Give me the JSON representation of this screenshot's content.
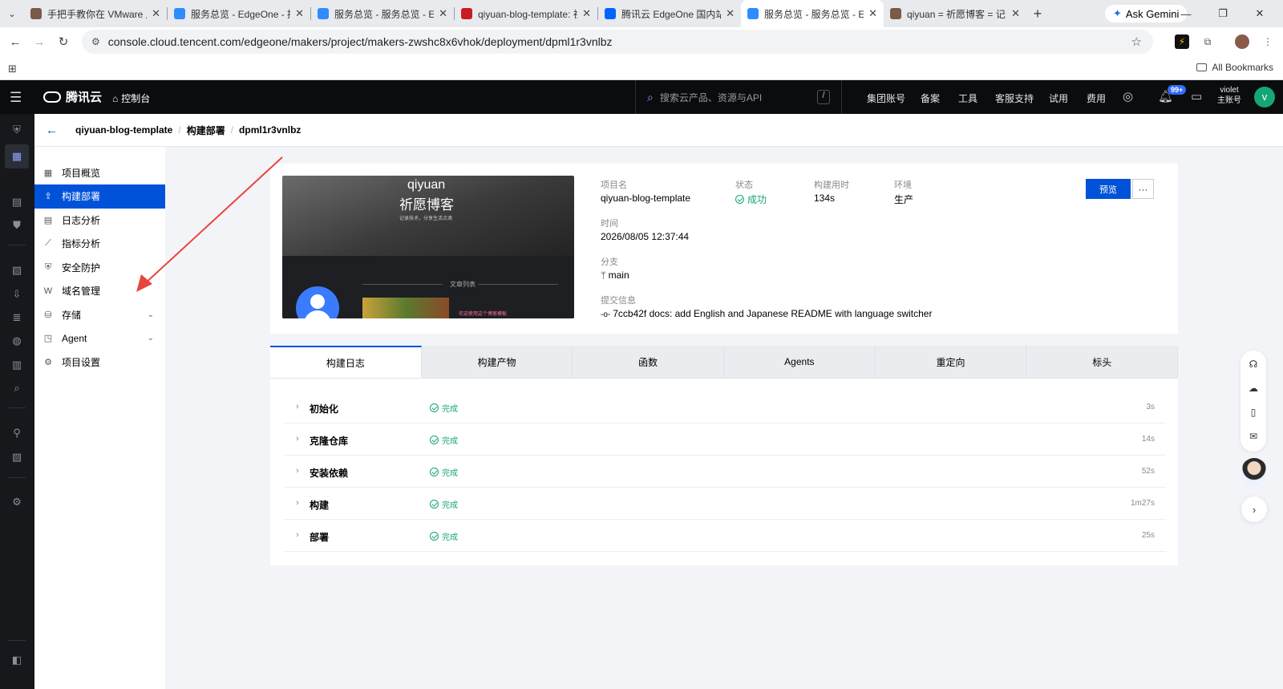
{
  "browser": {
    "tabs": [
      {
        "title": "手把手教你在 VMware 虚拟",
        "favicon_color": "#7a5a4a",
        "active": false
      },
      {
        "title": "服务总览 - EdgeOne - 控制",
        "favicon_color": "#2f8cff",
        "active": false
      },
      {
        "title": "服务总览 - 服务总览 - Edg",
        "favicon_color": "#2f8cff",
        "active": false
      },
      {
        "title": "qiyuan-blog-template: 祈",
        "favicon_color": "#c71d23",
        "active": false
      },
      {
        "title": "腾讯云 EdgeOne 国内站 Cl",
        "favicon_color": "#0066ff",
        "active": false
      },
      {
        "title": "服务总览 - 服务总览 - Edg",
        "favicon_color": "#2f8cff",
        "active": true
      },
      {
        "title": "qiyuan = 祈愿博客 = 记录",
        "favicon_color": "#7a5a4a",
        "active": false
      }
    ],
    "gemini_label": "Ask Gemini",
    "url": "console.cloud.tencent.com/edgeone/makers/project/makers-zwshc8x6vhok/deployment/dpml1r3vnlbz",
    "all_bookmarks": "All Bookmarks"
  },
  "header": {
    "brand": "腾讯云",
    "console": "控制台",
    "search_placeholder": "搜索云产品、资源与API",
    "search_shortcut": "/",
    "menu": [
      "集团账号",
      "备案",
      "工具",
      "客服支持",
      "试用",
      "费用"
    ],
    "notification_badge": "99+",
    "user_name": "violet",
    "user_role": "主账号",
    "avatar_letter": "v"
  },
  "breadcrumb": [
    "qiyuan-blog-template",
    "构建部署",
    "dpml1r3vnlbz"
  ],
  "sidenav": [
    {
      "label": "项目概览",
      "icon": "overview-icon",
      "active": false,
      "expandable": false
    },
    {
      "label": "构建部署",
      "icon": "deploy-icon",
      "active": true,
      "expandable": false
    },
    {
      "label": "日志分析",
      "icon": "log-icon",
      "active": false,
      "expandable": false
    },
    {
      "label": "指标分析",
      "icon": "chart-icon",
      "active": false,
      "expandable": false
    },
    {
      "label": "安全防护",
      "icon": "shield-icon",
      "active": false,
      "expandable": false
    },
    {
      "label": "域名管理",
      "icon": "domain-icon",
      "active": false,
      "expandable": false
    },
    {
      "label": "存储",
      "icon": "database-icon",
      "active": false,
      "expandable": true
    },
    {
      "label": "Agent",
      "icon": "agent-icon",
      "active": false,
      "expandable": true
    },
    {
      "label": "项目设置",
      "icon": "settings-icon",
      "active": false,
      "expandable": false
    }
  ],
  "deployment": {
    "thumbnail": {
      "site_title": "qiyuan",
      "site_subtitle": "祈愿博客",
      "tagline": "记录技术，分享生活点滴",
      "section": "文章列表",
      "banner": "欢迎使用这个博客模板"
    },
    "project_name_label": "项目名",
    "project_name": "qiyuan-blog-template",
    "status_label": "状态",
    "status": "成功",
    "build_time_label": "构建用时",
    "build_time": "134s",
    "env_label": "环境",
    "env": "生产",
    "time_label": "时间",
    "time": "2026/08/05 12:37:44",
    "branch_label": "分支",
    "branch": "main",
    "commit_label": "提交信息",
    "commit": "7ccb42f docs: add English and Japanese README with language switcher",
    "preview_button": "预览",
    "more_button": "···"
  },
  "content_tabs": [
    {
      "label": "构建日志",
      "active": true
    },
    {
      "label": "构建产物",
      "active": false
    },
    {
      "label": "函数",
      "active": false
    },
    {
      "label": "Agents",
      "active": false
    },
    {
      "label": "重定向",
      "active": false
    },
    {
      "label": "标头",
      "active": false
    }
  ],
  "build_steps": [
    {
      "name": "初始化",
      "status": "完成",
      "duration": "3s"
    },
    {
      "name": "克隆仓库",
      "status": "完成",
      "duration": "14s"
    },
    {
      "name": "安装依赖",
      "status": "完成",
      "duration": "52s"
    },
    {
      "name": "构建",
      "status": "完成",
      "duration": "1m27s"
    },
    {
      "name": "部署",
      "status": "完成",
      "duration": "25s"
    }
  ],
  "colors": {
    "accent": "#0052d9",
    "success": "#15a675",
    "annotation_arrow": "#e8453c"
  }
}
